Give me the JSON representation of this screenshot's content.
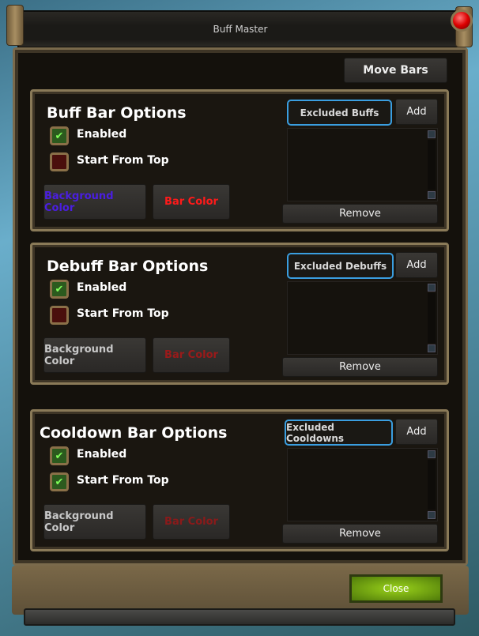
{
  "window": {
    "title": "Buff Master",
    "move_bars": "Move Bars",
    "close": "Close"
  },
  "sections": [
    {
      "title": "Buff Bar Options",
      "enabled": {
        "label": "Enabled",
        "checked": true
      },
      "start_from_top": {
        "label": "Start From Top",
        "checked": false
      },
      "background_color": {
        "label": "Background Color",
        "color": "#4a1ee0"
      },
      "bar_color": {
        "label": "Bar Color",
        "color": "#ff1a1a"
      },
      "excluded_label": "Excluded Buffs",
      "add": "Add",
      "remove": "Remove"
    },
    {
      "title": "Debuff Bar Options",
      "enabled": {
        "label": "Enabled",
        "checked": true
      },
      "start_from_top": {
        "label": "Start From Top",
        "checked": false
      },
      "background_color": {
        "label": "Background Color",
        "color": "#c8c8c8"
      },
      "bar_color": {
        "label": "Bar Color",
        "color": "#9a1a1a"
      },
      "excluded_label": "Excluded Debuffs",
      "add": "Add",
      "remove": "Remove"
    },
    {
      "title": "Cooldown Bar Options",
      "enabled": {
        "label": "Enabled",
        "checked": true
      },
      "start_from_top": {
        "label": "Start From Top",
        "checked": true
      },
      "background_color": {
        "label": "Background Color",
        "color": "#c8c8c8"
      },
      "bar_color": {
        "label": "Bar Color",
        "color": "#8a1a1a"
      },
      "excluded_label": "Excluded Cooldowns",
      "add": "Add",
      "remove": "Remove"
    }
  ]
}
